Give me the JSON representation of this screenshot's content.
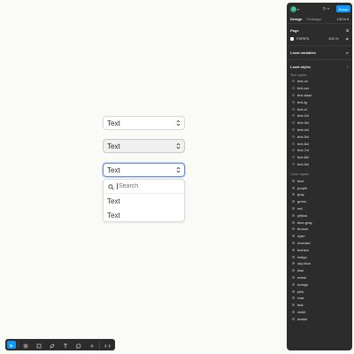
{
  "canvas": {
    "selects": [
      {
        "label": "Text",
        "state": "default"
      },
      {
        "label": "Text",
        "state": "hover"
      },
      {
        "label": "Text",
        "state": "focused"
      }
    ],
    "dropdown": {
      "search_placeholder": "Search",
      "options": [
        "Text",
        "Text"
      ]
    }
  },
  "toolbar": {
    "tools": [
      "move-icon",
      "frame-icon",
      "rectangle-icon",
      "pen-icon",
      "text-icon",
      "comment-icon",
      "actions-icon",
      "dev-mode-icon"
    ]
  },
  "panel": {
    "share_label": "Share",
    "tabs": [
      "Design",
      "Prototype"
    ],
    "zoom": "132%",
    "page": {
      "title": "Page",
      "hex": "F5F5F5",
      "opacity": "100",
      "opacity_unit": "%"
    },
    "local_variables": "Local variables",
    "local_styles": "Local styles",
    "text_styles_title": "Text styles",
    "text_styles": [
      "text-xs",
      "text-sm",
      "text-base",
      "text-lg",
      "text-xl",
      "text-2xl",
      "text-3xl",
      "text-4xl",
      "text-5xl",
      "text-6xl",
      "text-7xl",
      "text-8xl",
      "text-9xl"
    ],
    "color_styles_title": "Color styles",
    "color_styles": [
      "blue",
      "purple",
      "gray",
      "green",
      "red",
      "yellow",
      "blue-gray",
      "bronze",
      "cyan",
      "emerald",
      "fuchsia",
      "indigo",
      "sky-blue",
      "lime",
      "metal",
      "orange",
      "pink",
      "rose",
      "teal",
      "violet",
      "avatar"
    ]
  },
  "colors": {
    "accent": "#0d99ff",
    "panel_bg": "#2c2c2c",
    "canvas_bg": "#fafaf7",
    "focus_border": "#6b8fd6"
  }
}
